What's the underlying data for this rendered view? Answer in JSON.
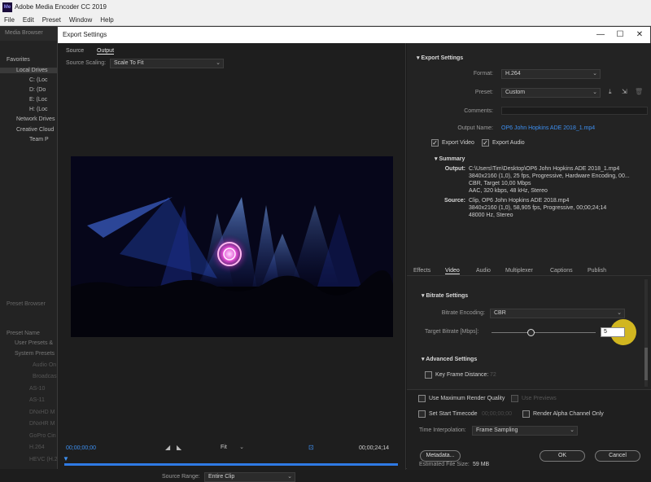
{
  "app": {
    "title": "Adobe Media Encoder CC 2019",
    "logo": "Me",
    "menu": [
      "File",
      "Edit",
      "Preset",
      "Window",
      "Help"
    ]
  },
  "background_panel": {
    "media_browser_label": "Media Browser",
    "tree": [
      "Favorites",
      "Local Drives",
      "C: (Loc",
      "D: (Do",
      "E: (Loc",
      "H: (Loc",
      "Network Drives",
      "Creative Cloud",
      "Team P"
    ],
    "preset_browser_label": "Preset Browser",
    "preset_items": [
      "Preset Name",
      "User Presets &",
      "System Presets",
      "Audio On",
      "Broadcast",
      "AS-10",
      "AS-11",
      "DNxHD M",
      "DNxHR M",
      "GoPro Cin",
      "H.264",
      "HEVC (H.2"
    ]
  },
  "dialog": {
    "title": "Export Settings",
    "controls": {
      "minimize": "—",
      "maximize": "☐",
      "close": "✕"
    },
    "left": {
      "tabs": [
        "Source",
        "Output"
      ],
      "active_tab": "Output",
      "source_scaling_label": "Source Scaling:",
      "source_scaling_value": "Scale To Fit",
      "timecode_start": "00;00;00;00",
      "fit_value": "Fit",
      "timecode_end": "00;00;24;14",
      "source_range_label": "Source Range:",
      "source_range_value": "Entire Clip"
    },
    "right": {
      "export_settings_header": "Export Settings",
      "format_label": "Format:",
      "format_value": "H.264",
      "preset_label": "Preset:",
      "preset_value": "Custom",
      "comments_label": "Comments:",
      "output_name_label": "Output Name:",
      "output_name_value": "OP6 John Hopkins ADE 2018_1.mp4",
      "export_video_label": "Export Video",
      "export_audio_label": "Export Audio",
      "summary_header": "Summary",
      "summary_output_label": "Output:",
      "summary_output_lines": [
        "C:\\Users\\Tim\\Desktop\\OP6 John Hopkins ADE 2018_1.mp4",
        "3840x2160 (1,0), 25 fps, Progressive, Hardware Encoding, 00...",
        "CBR, Target 10,00 Mbps",
        "AAC, 320 kbps, 48 kHz, Stereo"
      ],
      "summary_source_label": "Source:",
      "summary_source_lines": [
        "Clip, OP6 John Hopkins ADE 2018.mp4",
        "3840x2160 (1,0), 58,905 fps, Progressive, 00;00;24;14",
        "48000 Hz, Stereo"
      ],
      "tabs": [
        "Effects",
        "Video",
        "Audio",
        "Multiplexer",
        "Captions",
        "Publish"
      ],
      "active_tab": "Video",
      "bitrate_settings_header": "Bitrate Settings",
      "bitrate_encoding_label": "Bitrate Encoding:",
      "bitrate_encoding_value": "CBR",
      "target_bitrate_label": "Target Bitrate [Mbps]:",
      "target_bitrate_value": "5",
      "target_bitrate_slider_fraction": 0.38,
      "advanced_settings_header": "Advanced Settings",
      "key_frame_label": "Key Frame Distance:",
      "key_frame_value": "72",
      "max_render_quality_label": "Use Maximum Render Quality",
      "use_previews_label": "Use Previews",
      "set_start_timecode_label": "Set Start Timecode",
      "start_timecode_value": "00;00;00;00",
      "render_alpha_label": "Render Alpha Channel Only",
      "time_interpolation_label": "Time Interpolation:",
      "time_interpolation_value": "Frame Sampling",
      "estimated_size_label": "Estimated File Size:",
      "estimated_size_value": "59 MB",
      "metadata_button": "Metadata...",
      "ok_button": "OK",
      "cancel_button": "Cancel"
    }
  },
  "colors": {
    "accent_blue": "#3d8ff0",
    "cursor_highlight": "#f0d020",
    "timeline_blue": "#2f7ae5"
  }
}
